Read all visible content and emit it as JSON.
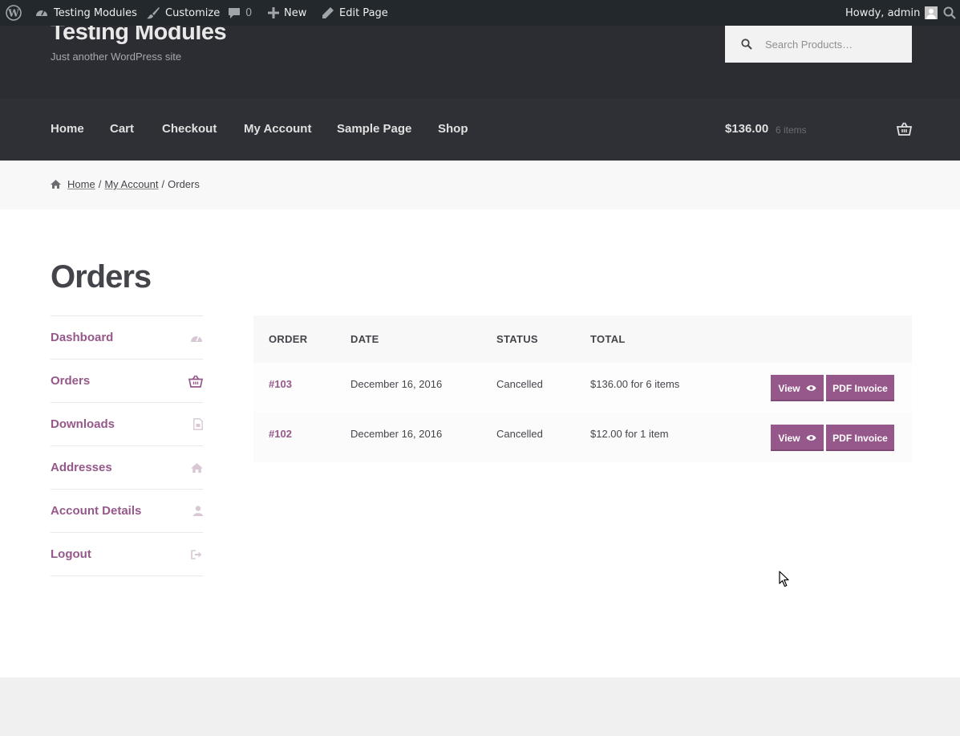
{
  "adminbar": {
    "site_name": "Testing Modules",
    "customize": "Customize",
    "comments_count": "0",
    "new": "New",
    "edit_page": "Edit Page",
    "howdy": "Howdy, admin"
  },
  "header": {
    "site_title": "Testing Modules",
    "site_description": "Just another WordPress site",
    "search_placeholder": "Search Products…"
  },
  "nav": {
    "items": [
      "Home",
      "Cart",
      "Checkout",
      "My Account",
      "Sample Page",
      "Shop"
    ],
    "cart_amount": "$136.00",
    "cart_count": "6 items"
  },
  "breadcrumb": {
    "home": "Home",
    "my_account": "My Account",
    "separator": "/",
    "current": "Orders"
  },
  "page": {
    "title": "Orders"
  },
  "account_nav": {
    "items": [
      {
        "label": "Dashboard",
        "icon": "dashboard-icon"
      },
      {
        "label": "Orders",
        "icon": "basket-icon"
      },
      {
        "label": "Downloads",
        "icon": "file-icon"
      },
      {
        "label": "Addresses",
        "icon": "home-icon"
      },
      {
        "label": "Account Details",
        "icon": "user-icon"
      },
      {
        "label": "Logout",
        "icon": "sign-out-icon"
      }
    ]
  },
  "orders": {
    "headers": [
      "ORDER",
      "DATE",
      "STATUS",
      "TOTAL"
    ],
    "rows": [
      {
        "order": "#103",
        "date": "December 16, 2016",
        "status": "Cancelled",
        "total": "$136.00 for 6 items",
        "view": "View",
        "invoice": "PDF Invoice"
      },
      {
        "order": "#102",
        "date": "December 16, 2016",
        "status": "Cancelled",
        "total": "$12.00 for 1 item",
        "view": "View",
        "invoice": "PDF Invoice"
      }
    ]
  },
  "colors": {
    "accent": "#96588a",
    "adminbar": "#23282d",
    "header": "#2c2d33"
  }
}
